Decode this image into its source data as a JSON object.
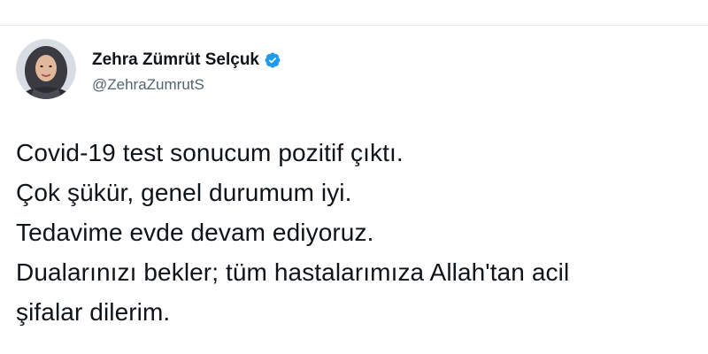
{
  "tweet": {
    "author": {
      "display_name": "Zehra Zümrüt Selçuk",
      "handle": "@ZehraZumrutS",
      "verified_icon": "verified-badge-icon",
      "avatar": "profile-photo"
    },
    "text_lines": [
      "Covid-19 test sonucum pozitif çıktı.",
      "Çok şükür, genel durumum iyi.",
      "Tedavime evde devam ediyoruz.",
      "Dualarınızı bekler; tüm hastalarımıza Allah'tan acil",
      "şifalar dilerim."
    ]
  },
  "colors": {
    "verified": "#1d9bf0",
    "handle": "#536471",
    "text": "#0f1419",
    "rule": "#e6ecf0"
  }
}
